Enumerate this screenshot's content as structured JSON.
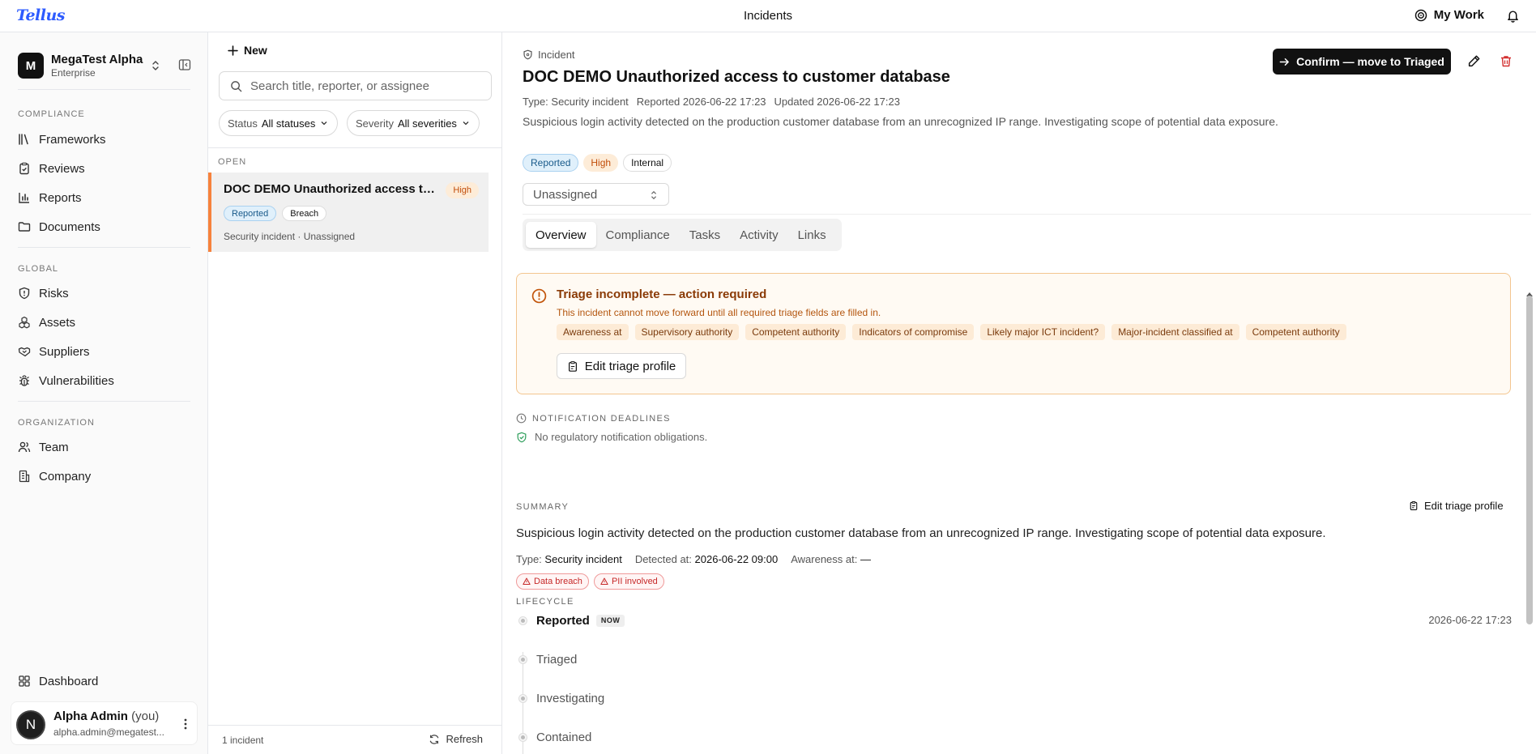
{
  "app": {
    "logo": "Tellus",
    "page_title": "Incidents",
    "my_work": "My Work"
  },
  "sidebar": {
    "org_initial": "M",
    "org_name": "MegaTest Alpha",
    "org_plan": "Enterprise",
    "sections": [
      {
        "label": "COMPLIANCE",
        "items": [
          {
            "label": "Frameworks",
            "icon": "books-icon"
          },
          {
            "label": "Reviews",
            "icon": "clipboard-check-icon"
          },
          {
            "label": "Reports",
            "icon": "bar-chart-icon"
          },
          {
            "label": "Documents",
            "icon": "folder-icon"
          }
        ]
      },
      {
        "label": "GLOBAL",
        "items": [
          {
            "label": "Risks",
            "icon": "shield-alert-icon"
          },
          {
            "label": "Assets",
            "icon": "boxes-icon"
          },
          {
            "label": "Suppliers",
            "icon": "handshake-icon"
          },
          {
            "label": "Vulnerabilities",
            "icon": "bug-icon"
          }
        ]
      },
      {
        "label": "ORGANIZATION",
        "items": [
          {
            "label": "Team",
            "icon": "users-icon"
          },
          {
            "label": "Company",
            "icon": "building-icon"
          }
        ]
      }
    ],
    "dashboard": "Dashboard",
    "user": {
      "initial": "N",
      "name": "Alpha Admin",
      "you": "(you)",
      "email": "alpha.admin@megatest..."
    }
  },
  "list": {
    "new_label": "New",
    "search_placeholder": "Search title, reporter, or assignee",
    "filters": [
      {
        "key": "Status",
        "value": "All statuses"
      },
      {
        "key": "Severity",
        "value": "All severities"
      }
    ],
    "section": "OPEN",
    "items": [
      {
        "title": "DOC DEMO Unauthorized access to customer database",
        "severity": "High",
        "badges": [
          "Reported",
          "Breach"
        ],
        "sub": "Security incident · Unassigned"
      }
    ],
    "count": "1 incident",
    "refresh": "Refresh"
  },
  "detail": {
    "kind": "Incident",
    "title": "DOC DEMO Unauthorized access to customer database",
    "meta": {
      "type": "Type: Security incident",
      "reported": "Reported 2026-06-22 17:23",
      "updated": "Updated 2026-06-22 17:23"
    },
    "description": "Suspicious login activity detected on the production customer database from an unrecognized IP range. Investigating scope of potential data exposure.",
    "badges": {
      "status": "Reported",
      "severity": "High",
      "scope": "Internal"
    },
    "assignee": "Unassigned",
    "confirm_label": "Confirm — move to Triaged",
    "tabs": [
      "Overview",
      "Compliance",
      "Tasks",
      "Activity",
      "Links"
    ],
    "alert": {
      "title": "Triage incomplete — action required",
      "text": "This incident cannot move forward until all required triage fields are filled in.",
      "chips": [
        "Awareness at",
        "Supervisory authority",
        "Competent authority",
        "Indicators of compromise",
        "Likely major ICT incident?",
        "Major-incident classified at",
        "Competent authority"
      ],
      "button": "Edit triage profile"
    },
    "notification": {
      "label": "NOTIFICATION DEADLINES",
      "text": "No regulatory notification obligations."
    },
    "summary": {
      "label": "SUMMARY",
      "edit": "Edit triage profile",
      "text": "Suspicious login activity detected on the production customer database from an unrecognized IP range. Investigating scope of potential data exposure.",
      "type_key": "Type:",
      "type_val": "Security incident",
      "detected_key": "Detected at:",
      "detected_val": "2026-06-22 09:00",
      "awareness_key": "Awareness at:",
      "awareness_val": "—",
      "flags": [
        "Data breach",
        "PII involved"
      ]
    },
    "lifecycle": {
      "label": "LIFECYCLE",
      "now": "NOW",
      "current_date": "2026-06-22 17:23",
      "steps": [
        "Reported",
        "Triaged",
        "Investigating",
        "Contained"
      ]
    }
  },
  "colors": {
    "accent": "#2d5bff",
    "warning": "#f7823c",
    "danger": "#c62828"
  }
}
